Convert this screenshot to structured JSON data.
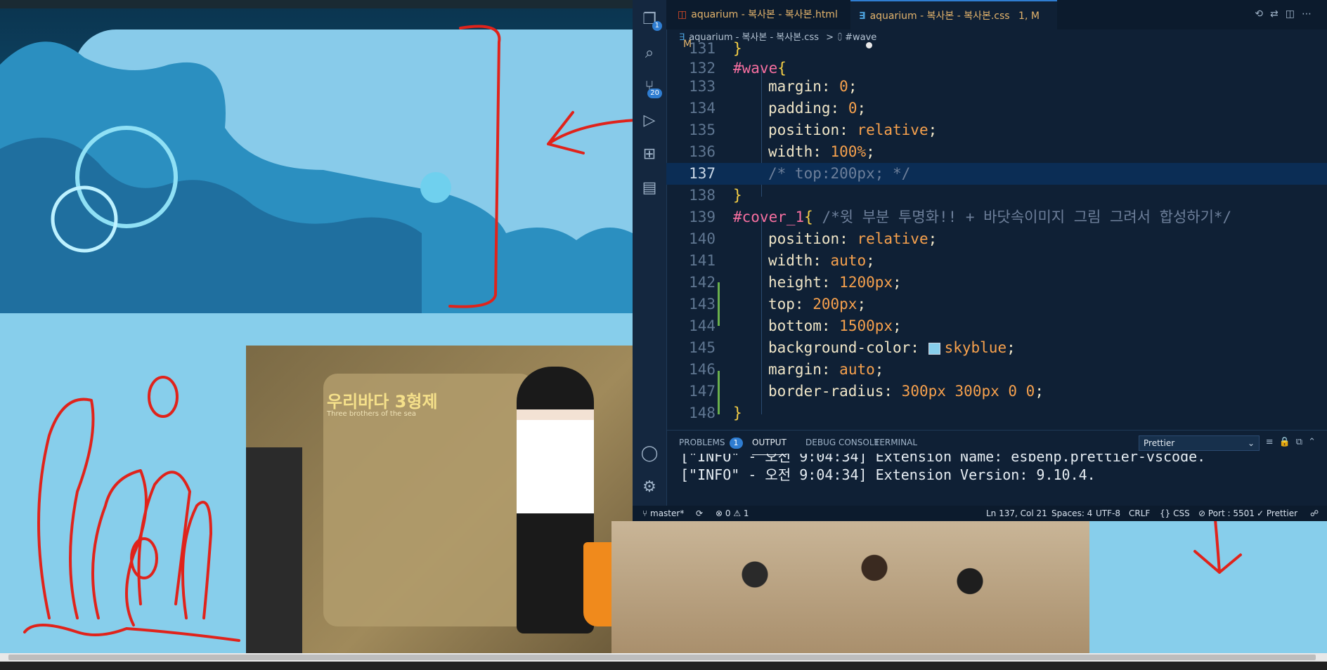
{
  "editor_tabs": [
    {
      "label": "aquarium - 복사본 - 복사본.html",
      "status": "M"
    },
    {
      "label": "aquarium - 복사본 - 복사본.css",
      "status": "1, M"
    }
  ],
  "breadcrumb": {
    "file": "aquarium - 복사본 - 복사본.css",
    "separator": ">",
    "symbol": "#wave"
  },
  "activity_bar": {
    "explorer_badge": "1",
    "source_control_badge": "20",
    "icons": [
      "files-icon",
      "search-icon",
      "source-control-icon",
      "run-debug-icon",
      "extensions-icon",
      "remote-icon",
      "account-icon",
      "settings-gear-icon"
    ]
  },
  "code_lines": [
    {
      "n": "131",
      "text": "}"
    },
    {
      "n": "132",
      "text": "#wave{"
    },
    {
      "n": "133",
      "text": "margin: 0;"
    },
    {
      "n": "134",
      "text": "padding: 0;"
    },
    {
      "n": "135",
      "text": "position: relative;"
    },
    {
      "n": "136",
      "text": "width: 100%;"
    },
    {
      "n": "137",
      "text": "/* top:200px; */"
    },
    {
      "n": "138",
      "text": "}"
    },
    {
      "n": "139",
      "text": "#cover_1{ /*윗 부분 투명화!! + 바닷속이미지 그림 그려서 합성하기*/"
    },
    {
      "n": "140",
      "text": "position: relative;"
    },
    {
      "n": "141",
      "text": "width: auto;"
    },
    {
      "n": "142",
      "text": "height: 1200px;"
    },
    {
      "n": "143",
      "text": "top: 200px;"
    },
    {
      "n": "144",
      "text": "bottom: 1500px;"
    },
    {
      "n": "145",
      "text": "background-color: skyblue;"
    },
    {
      "n": "146",
      "text": "margin: auto;"
    },
    {
      "n": "147",
      "text": "border-radius: 300px 300px 0 0;"
    },
    {
      "n": "148",
      "text": "}"
    }
  ],
  "code_tokens": {
    "l131_brace": "}",
    "l132_sel": "#wave",
    "l132_brace": "{",
    "l133_prop": "margin:",
    "l133_val": "0",
    "l134_prop": "padding:",
    "l134_val": "0",
    "l135_prop": "position:",
    "l135_val": "relative",
    "l136_prop": "width:",
    "l136_val": "100%",
    "l137_comment": "/* top:200px; */",
    "l138_brace": "}",
    "l139_sel": "#cover_1",
    "l139_brace": "{",
    "l139_comment": "/*윗 부분 투명화!! + 바닷속이미지 그림 그려서 합성하기*/",
    "l140_prop": "position:",
    "l140_val": "relative",
    "l141_prop": "width:",
    "l141_val": "auto",
    "l142_prop": "height:",
    "l142_val": "1200px",
    "l143_prop": "top:",
    "l143_val": "200px",
    "l144_prop": "bottom:",
    "l144_val": "1500px",
    "l145_prop": "background-color:",
    "l145_val": "skyblue",
    "l146_prop": "margin:",
    "l146_val": "auto",
    "l147_prop": "border-radius:",
    "l147_val": "300px 300px 0 0",
    "l148_brace": "}",
    "semicolon": ";"
  },
  "panel": {
    "tabs": [
      {
        "label": "PROBLEMS",
        "badge": "1"
      },
      {
        "label": "OUTPUT"
      },
      {
        "label": "DEBUG CONSOLE"
      },
      {
        "label": "TERMINAL"
      }
    ],
    "output_channel": "Prettier",
    "output_lines": [
      "[\"INFO\" - 오전 9:04:34] Extension Name: esbenp.prettier-vscode.",
      "[\"INFO\" - 오전 9:04:34] Extension Version: 9.10.4."
    ]
  },
  "status_bar": {
    "branch": "master*",
    "sync_icon": "⟳",
    "errors": "0",
    "warnings": "1",
    "cursor": "Ln 137, Col 21",
    "spaces": "Spaces: 4",
    "encoding": "UTF-8",
    "eol": "CRLF",
    "language": "CSS",
    "port": "Port : 5501",
    "formatter": "Prettier"
  },
  "webpage": {
    "exhibit_title": "우리바다 3형제",
    "exhibit_subtitle": "Three brothers of the sea",
    "sky_color": "#87ceeb"
  },
  "colors": {
    "editor_bg": "#0f2035",
    "accent": "#2f7dd1",
    "annotation_red": "#e0231b"
  }
}
